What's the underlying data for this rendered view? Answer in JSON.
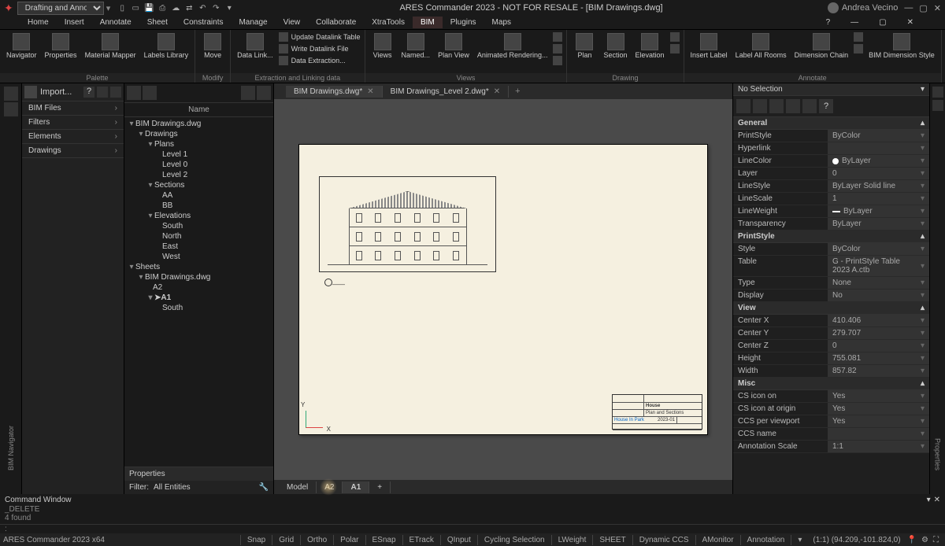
{
  "titlebar": {
    "workspace": "Drafting and Annotation",
    "app_title": "ARES Commander 2023 - NOT FOR RESALE - [BIM Drawings.dwg]",
    "user": "Andrea Vecino"
  },
  "menubar": {
    "items": [
      "Home",
      "Insert",
      "Annotate",
      "Sheet",
      "Constraints",
      "Manage",
      "View",
      "Collaborate",
      "XtraTools",
      "BIM",
      "Plugins",
      "Maps"
    ],
    "active": "BIM"
  },
  "ribbon": {
    "groups": [
      {
        "label": "Palette",
        "items": [
          "Navigator",
          "Properties",
          "Material Mapper",
          "Labels Library"
        ]
      },
      {
        "label": "Modify",
        "items": [
          "Move"
        ]
      },
      {
        "label": "Extraction and Linking data",
        "big": [
          "Data Link..."
        ],
        "small": [
          "Update Datalink Table",
          "Write Datalink File",
          "Data Extraction..."
        ]
      },
      {
        "label": "Views",
        "items": [
          "Views",
          "Named...",
          "Plan View",
          "Animated Rendering..."
        ]
      },
      {
        "label": "Drawing",
        "items": [
          "Plan",
          "Section",
          "Elevation"
        ]
      },
      {
        "label": "Annotate",
        "items": [
          "Insert Label",
          "Label All Rooms",
          "Dimension Chain",
          "BIM Dimension Style"
        ]
      }
    ]
  },
  "nav_panel": {
    "import": "Import...",
    "rows": [
      "BIM Files",
      "Filters",
      "Elements",
      "Drawings"
    ]
  },
  "tree": {
    "header": "Name",
    "root": "BIM Drawings.dwg",
    "drawings": "Drawings",
    "plans": "Plans",
    "plan_items": [
      "Level 1",
      "Level 0",
      "Level 2"
    ],
    "sections": "Sections",
    "section_items": [
      "AA",
      "BB"
    ],
    "elevations": "Elevations",
    "elev_items": [
      "South",
      "North",
      "East",
      "West"
    ],
    "sheets": "Sheets",
    "sheets_file": "BIM Drawings.dwg",
    "sheet_items": [
      "A2",
      "A1"
    ],
    "a1_child": "South",
    "props_title": "Properties",
    "filter_label": "Filter:",
    "filter_value": "All Entities"
  },
  "doc_tabs": {
    "tabs": [
      "BIM Drawings.dwg*",
      "BIM Drawings_Level 2.dwg*"
    ],
    "active": 0
  },
  "title_block": {
    "house": "House",
    "sub": "Plan and Sections",
    "project": "House In Park",
    "date": "2023-01"
  },
  "layout_tabs": {
    "tabs": [
      "Model",
      "A2",
      "A1"
    ],
    "active": "A1"
  },
  "axis": {
    "y": "Y",
    "x": "X"
  },
  "props": {
    "selection": "No Selection",
    "sections": {
      "General": [
        {
          "k": "PrintStyle",
          "v": "ByColor"
        },
        {
          "k": "Hyperlink",
          "v": ""
        },
        {
          "k": "LineColor",
          "v": "ByLayer",
          "dot": true
        },
        {
          "k": "Layer",
          "v": "0"
        },
        {
          "k": "LineStyle",
          "v": "ByLayer    Solid line"
        },
        {
          "k": "LineScale",
          "v": "1"
        },
        {
          "k": "LineWeight",
          "v": "ByLayer",
          "line": true
        },
        {
          "k": "Transparency",
          "v": "ByLayer"
        }
      ],
      "PrintStyle": [
        {
          "k": "Style",
          "v": "ByColor"
        },
        {
          "k": "Table",
          "v": "G - PrintStyle Table 2023 A.ctb"
        },
        {
          "k": "Type",
          "v": "None"
        },
        {
          "k": "Display",
          "v": "No"
        }
      ],
      "View": [
        {
          "k": "Center X",
          "v": "410.406"
        },
        {
          "k": "Center Y",
          "v": "279.707"
        },
        {
          "k": "Center Z",
          "v": "0"
        },
        {
          "k": "Height",
          "v": "755.081"
        },
        {
          "k": "Width",
          "v": "857.82"
        }
      ],
      "Misc": [
        {
          "k": "CS icon on",
          "v": "Yes"
        },
        {
          "k": "CS icon at origin",
          "v": "Yes"
        },
        {
          "k": "CCS per viewport",
          "v": "Yes"
        },
        {
          "k": "CCS name",
          "v": ""
        },
        {
          "k": "Annotation Scale",
          "v": "1:1"
        }
      ]
    }
  },
  "cmd": {
    "title": "Command Window",
    "line1": "_DELETE",
    "line2": "4 found",
    "prompt": ":"
  },
  "statusbar": {
    "left": "ARES Commander 2023 x64",
    "buttons": [
      "Snap",
      "Grid",
      "Ortho",
      "Polar",
      "ESnap",
      "ETrack",
      "QInput",
      "Cycling Selection",
      "LWeight",
      "SHEET",
      "Dynamic CCS",
      "AMonitor",
      "Annotation"
    ],
    "coords": "(1:1)   (94.209,-101.824,0)"
  }
}
